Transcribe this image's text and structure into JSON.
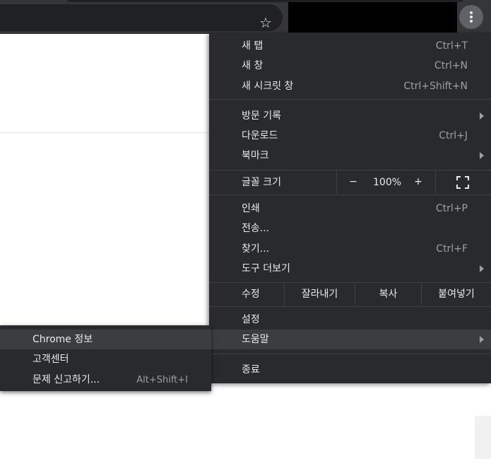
{
  "toolbar": {
    "bookmark_icon": "star-outline-icon",
    "menu_icon": "vertical-dots-icon"
  },
  "menu": {
    "new_tab": {
      "label": "새 탭",
      "shortcut": "Ctrl+T"
    },
    "new_window": {
      "label": "새 창",
      "shortcut": "Ctrl+N"
    },
    "incognito": {
      "label": "새 시크릿 창",
      "shortcut": "Ctrl+Shift+N"
    },
    "history": {
      "label": "방문 기록"
    },
    "downloads": {
      "label": "다운로드",
      "shortcut": "Ctrl+J"
    },
    "bookmarks": {
      "label": "북마크"
    },
    "zoom": {
      "label": "글꼴 크기",
      "minus": "−",
      "value": "100%",
      "plus": "+",
      "fullscreen_icon": "fullscreen-icon"
    },
    "print": {
      "label": "인쇄",
      "shortcut": "Ctrl+P"
    },
    "cast": {
      "label": "전송..."
    },
    "find": {
      "label": "찾기...",
      "shortcut": "Ctrl+F"
    },
    "more_tools": {
      "label": "도구 더보기"
    },
    "edit": {
      "label": "수정",
      "cut": "잘라내기",
      "copy": "복사",
      "paste": "붙여넣기"
    },
    "settings": {
      "label": "설정"
    },
    "help": {
      "label": "도움말"
    },
    "exit": {
      "label": "종료"
    }
  },
  "help_submenu": {
    "about": {
      "label": "Chrome 정보"
    },
    "help_center": {
      "label": "고객센터"
    },
    "report_issue": {
      "label": "문제 신고하기...",
      "shortcut": "Alt+Shift+I"
    }
  },
  "colors": {
    "menu_bg": "#292a2d",
    "highlight": "#3c3d41",
    "text": "#e8eaed",
    "shortcut_text": "#9aa0a6"
  }
}
